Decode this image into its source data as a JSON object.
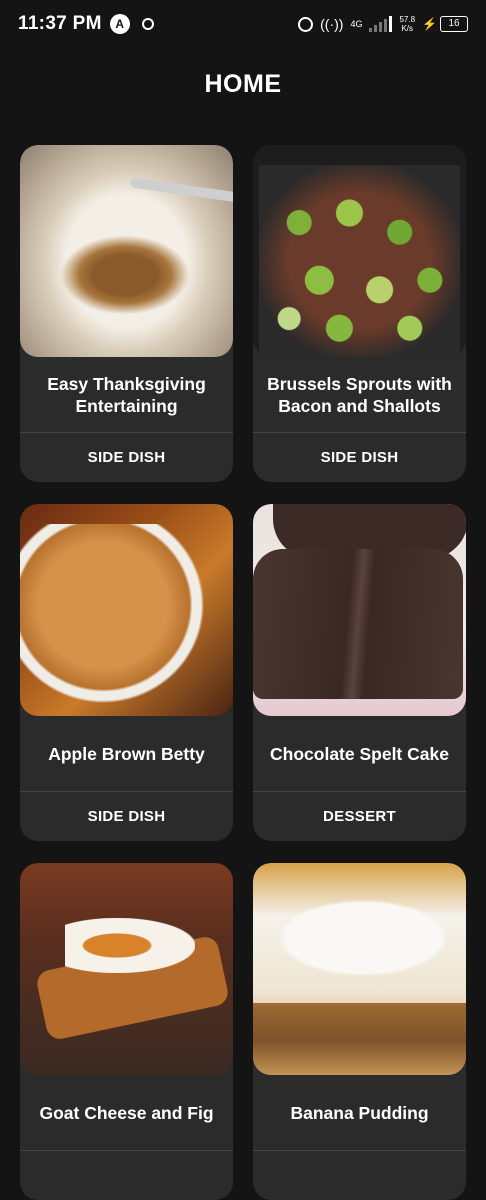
{
  "status_bar": {
    "time": "11:37 PM",
    "app_icon": "A",
    "network_type": "4G",
    "speed_value": "57.8",
    "speed_unit": "K/s",
    "battery": "16"
  },
  "header": {
    "title": "HOME"
  },
  "recipes": [
    {
      "name": "Easy Thanksgiving Entertaining",
      "category": "SIDE DISH"
    },
    {
      "name": "Brussels Sprouts with Bacon and Shallots",
      "category": "SIDE DISH"
    },
    {
      "name": "Apple Brown Betty",
      "category": "SIDE DISH"
    },
    {
      "name": "Chocolate Spelt Cake",
      "category": "DESSERT"
    },
    {
      "name": "Goat Cheese and Fig",
      "category": ""
    },
    {
      "name": "Banana Pudding",
      "category": ""
    }
  ]
}
